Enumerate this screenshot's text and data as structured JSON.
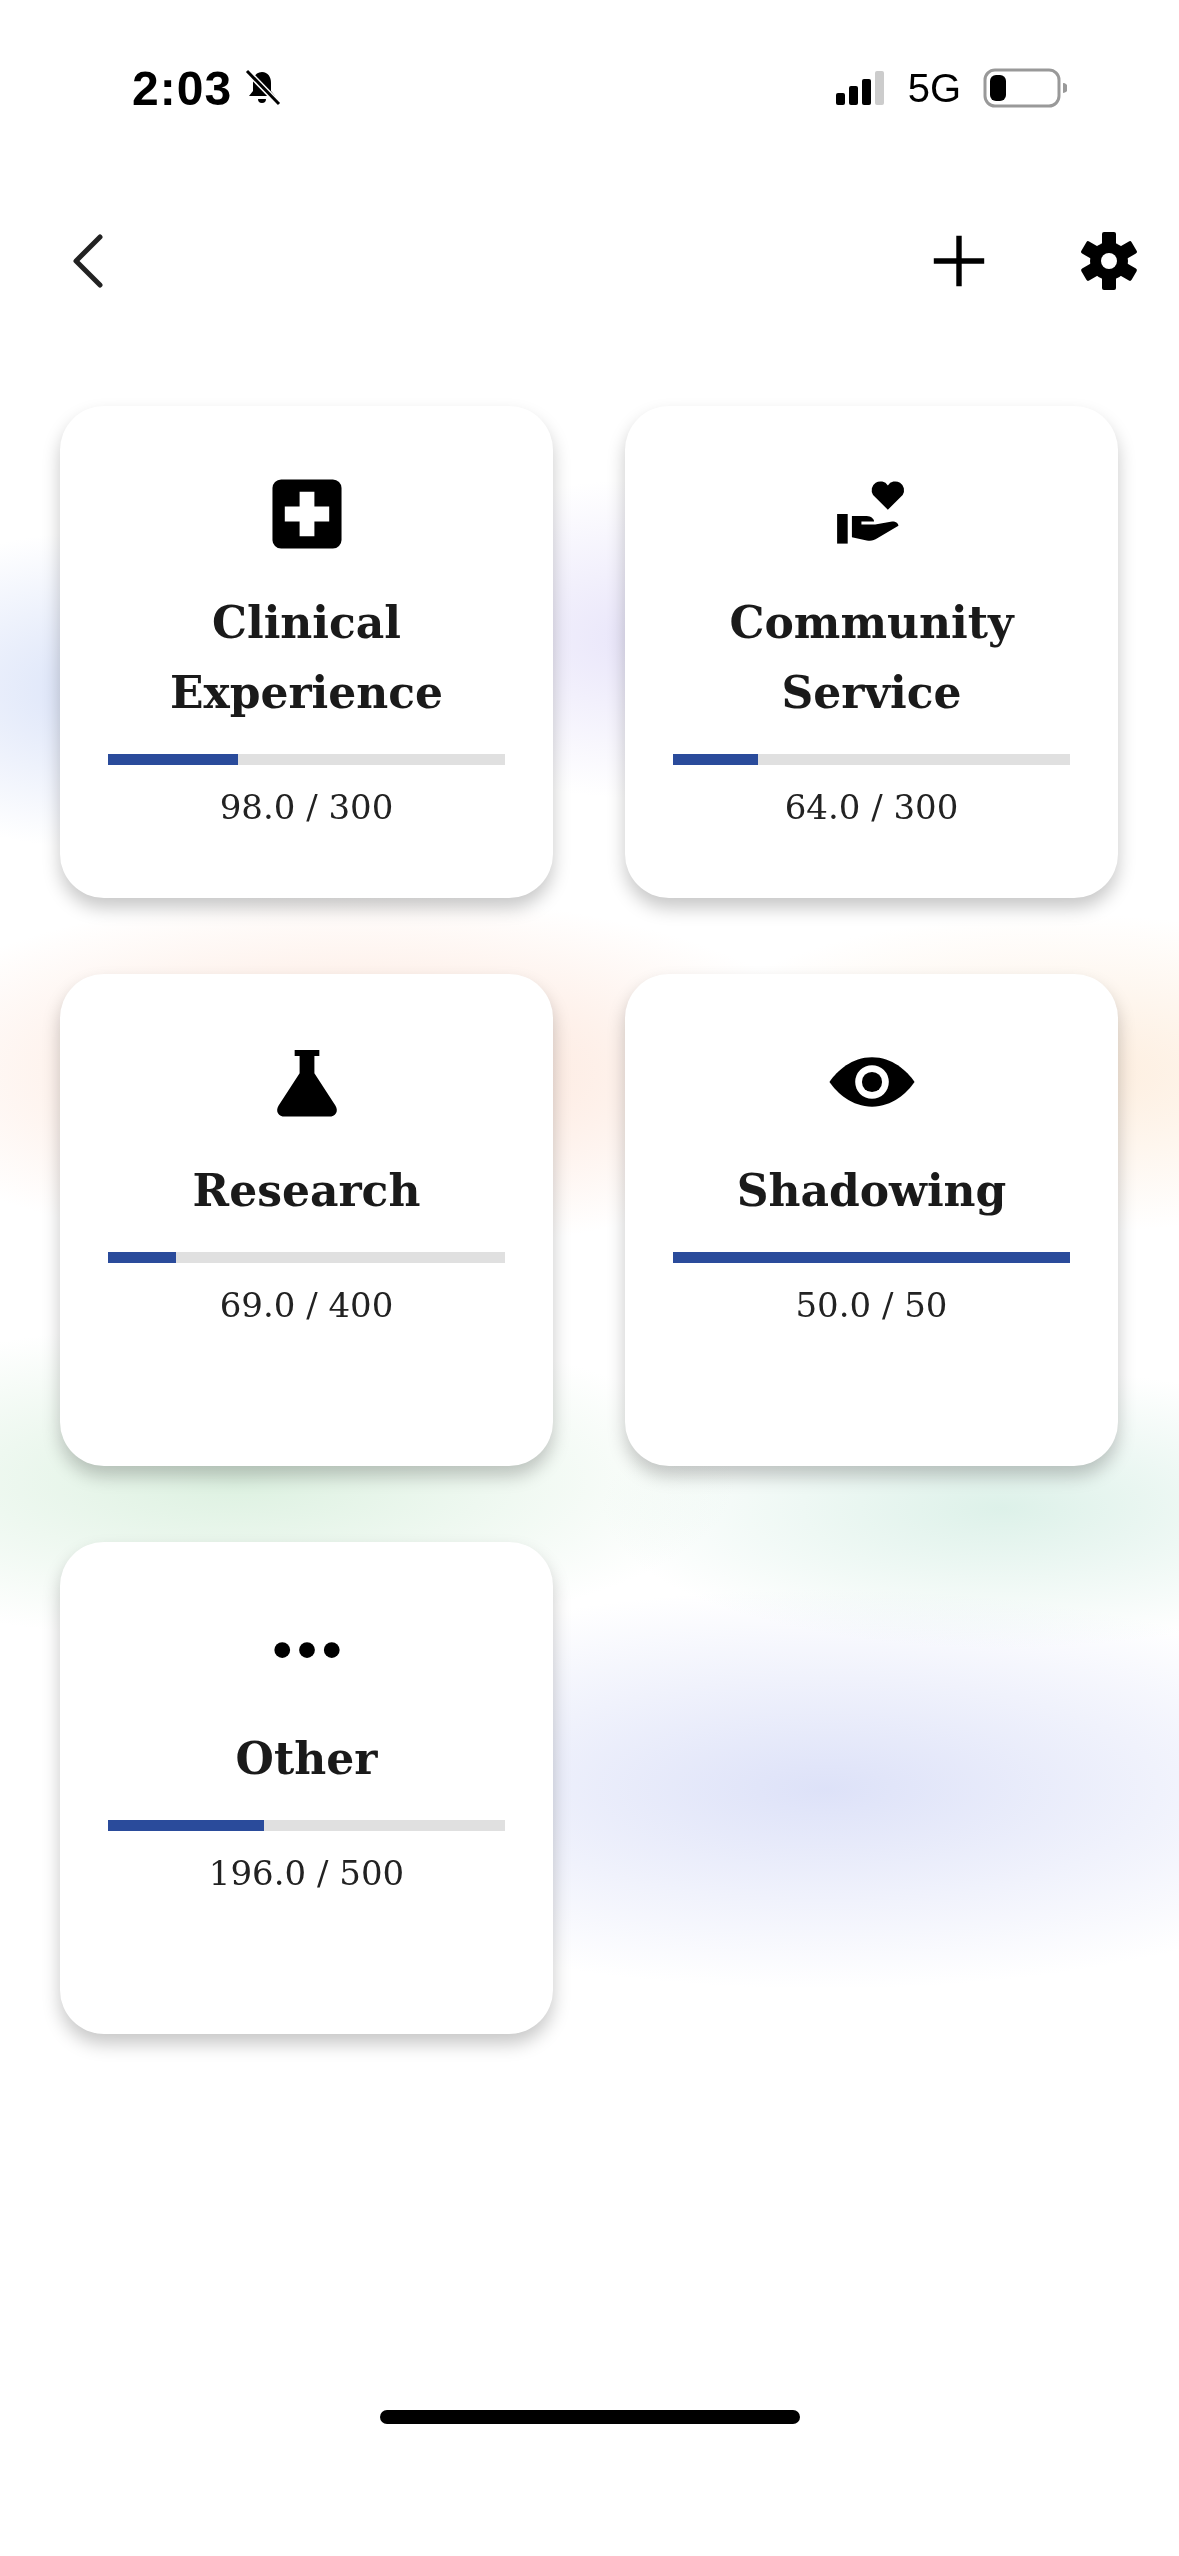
{
  "status_bar": {
    "time": "2:03",
    "network": "5G"
  },
  "categories": [
    {
      "kind": "medical",
      "title": "Clinical Experience",
      "level": 0.327,
      "reading": "98.0 / 300"
    },
    {
      "kind": "charity",
      "title": "Community Service",
      "level": 0.213,
      "reading": "64.0 / 300"
    },
    {
      "kind": "flask",
      "title": "Research",
      "level": 0.1725,
      "reading": "69.0 / 400"
    },
    {
      "kind": "eye",
      "title": "Shadowing",
      "level": 1,
      "reading": "50.0 / 50"
    },
    {
      "kind": "dots",
      "title": "Other",
      "level": 0.392,
      "reading": "196.0 / 500"
    }
  ]
}
